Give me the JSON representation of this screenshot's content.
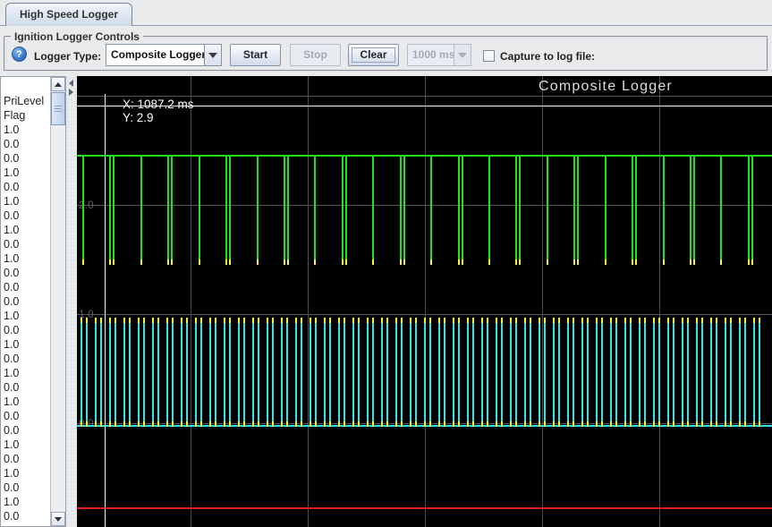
{
  "tab": {
    "label": "High Speed Logger"
  },
  "controls": {
    "group_title": "Ignition Logger Controls",
    "help_icon_glyph": "?",
    "logger_type_label": "Logger Type:",
    "logger_type_value": "Composite Logger",
    "start_label": "Start",
    "stop_label": "Stop",
    "clear_label": "Clear",
    "interval_value": "1000 ms",
    "capture_label": "Capture to log file:",
    "capture_checked": false,
    "start_enabled": true,
    "stop_enabled": false,
    "clear_enabled": true,
    "interval_enabled": false
  },
  "signal_list": {
    "items": [
      "PriLevel",
      "Flag",
      "1.0",
      "0.0",
      "0.0",
      "1.0",
      "0.0",
      "1.0",
      "0.0",
      "1.0",
      "0.0",
      "1.0",
      "0.0",
      "0.0",
      "0.0",
      "1.0",
      "0.0",
      "1.0",
      "0.0",
      "1.0",
      "0.0",
      "1.0",
      "0.0",
      "0.0",
      "1.0",
      "0.0",
      "1.0",
      "0.0",
      "1.0",
      "0.0"
    ]
  },
  "chart": {
    "title": "Composite Logger",
    "bg_color": "#000000",
    "grid_color": "#565656",
    "crosshair": {
      "x_text": "X: 1087.2 ms",
      "y_text": "Y: 2.9",
      "x_value_ms": 1087.2,
      "y_value": 2.9
    },
    "y_ticks": [
      {
        "label": "2.0",
        "value": 2.0
      },
      {
        "label": "1.0",
        "value": 1.0
      },
      {
        "label": "0.0",
        "value": 0.0
      }
    ],
    "y_gridline_values": [
      3.0,
      2.0,
      1.0,
      0.0
    ],
    "series": [
      {
        "name": "primary-level-green",
        "type": "square-pulse-down",
        "color": "#1de21d",
        "marker_color": "#f4f442",
        "high": 2.45,
        "low": 1.5
      },
      {
        "name": "flag-cyan",
        "type": "square-pulse-up",
        "color": "#35e3e3",
        "marker_color": "#f4f442",
        "high": 0.97,
        "low": -0.03
      },
      {
        "name": "reference-red",
        "type": "flat-line",
        "color": "#dd1c1c",
        "value": -0.78
      }
    ]
  }
}
